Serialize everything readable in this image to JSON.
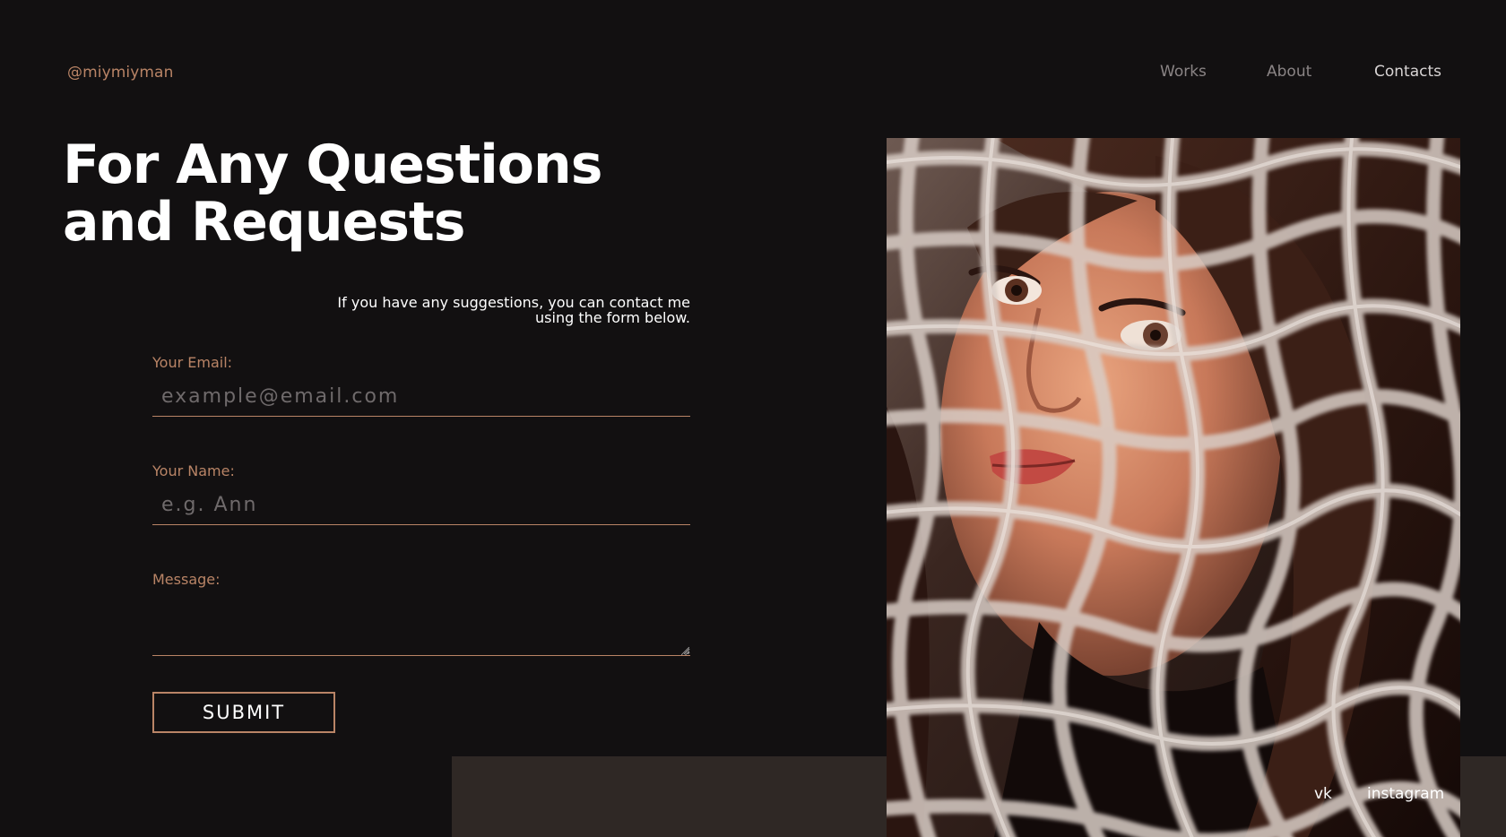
{
  "brand": {
    "handle": "@miymiyman"
  },
  "nav": {
    "items": [
      {
        "label": "Works",
        "active": false
      },
      {
        "label": "About",
        "active": false
      },
      {
        "label": "Contacts",
        "active": true
      }
    ]
  },
  "hero": {
    "title_line1": "For Any Questions",
    "title_line2": "and Requests",
    "intro_line1": "If you have any suggestions, you can contact me",
    "intro_line2": "using the form below."
  },
  "form": {
    "email_label": "Your Email:",
    "email_placeholder": "example@email.com",
    "email_value": "",
    "name_label": "Your Name:",
    "name_placeholder": "e.g. Ann",
    "name_value": "",
    "message_label": "Message:",
    "message_value": "",
    "submit_label": "SUBMIT"
  },
  "photo": {
    "subject": "portrait-behind-net"
  },
  "social": {
    "vk": "vk",
    "instagram": "instagram"
  },
  "colors": {
    "background": "#121011",
    "accent": "#b98466",
    "band": "#2f2825",
    "nav_inactive": "#8a8485",
    "text": "#ffffff"
  }
}
